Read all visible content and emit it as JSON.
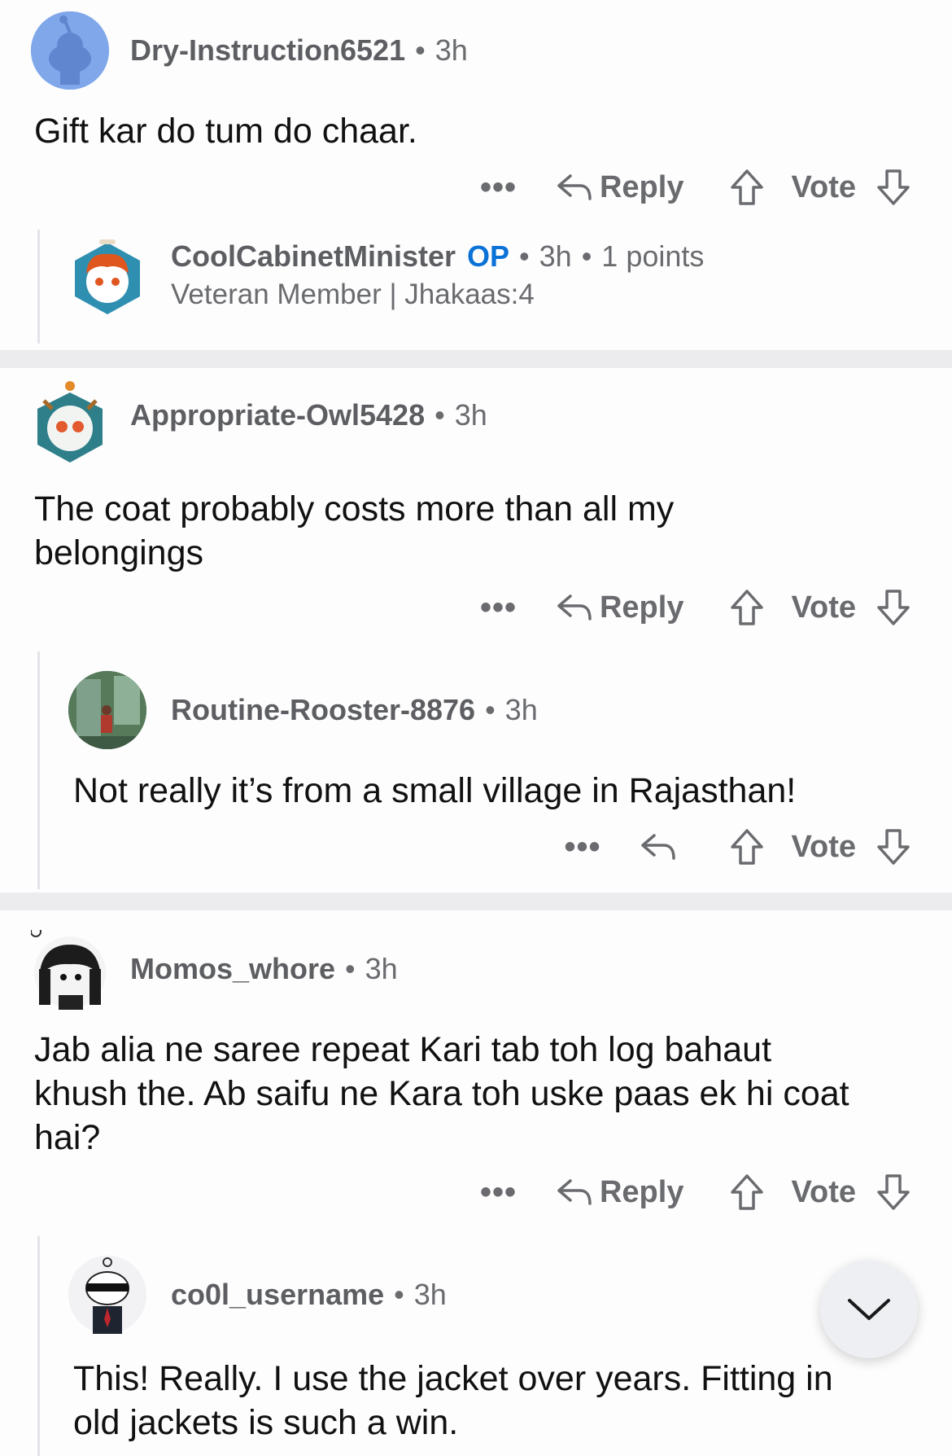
{
  "separator": "•",
  "actions": {
    "more": "•••",
    "reply": "Reply",
    "vote": "Vote"
  },
  "comments": [
    {
      "user": "Dry-Instruction6521",
      "time": "3h",
      "text": "Gift kar do tum do chaar."
    },
    {
      "user": "CoolCabinetMinister",
      "op": "OP",
      "time": "3h",
      "points": "1 points",
      "flair": "Veteran Member | Jhakaas:4"
    },
    {
      "user": "Appropriate-Owl5428",
      "time": "3h",
      "text": "The coat probably costs more than all my\nbelongings"
    },
    {
      "user": "Routine-Rooster-8876",
      "time": "3h",
      "text": "Not really it’s from a small village in Rajasthan!"
    },
    {
      "user": "Momos_whore",
      "time": "3h",
      "text": "Jab alia ne saree repeat Kari tab toh log bahaut\nkhush the. Ab saifu ne Kara toh uske paas ek hi coat\nhai?"
    },
    {
      "user": "co0l_username",
      "time": "3h",
      "text": "This! Really. I use the jacket over years. Fitting in\nold jackets is such a win."
    }
  ],
  "colors": {
    "op": "#0a72d6",
    "meta": "#6a6b6e",
    "separator": "#ececef"
  }
}
